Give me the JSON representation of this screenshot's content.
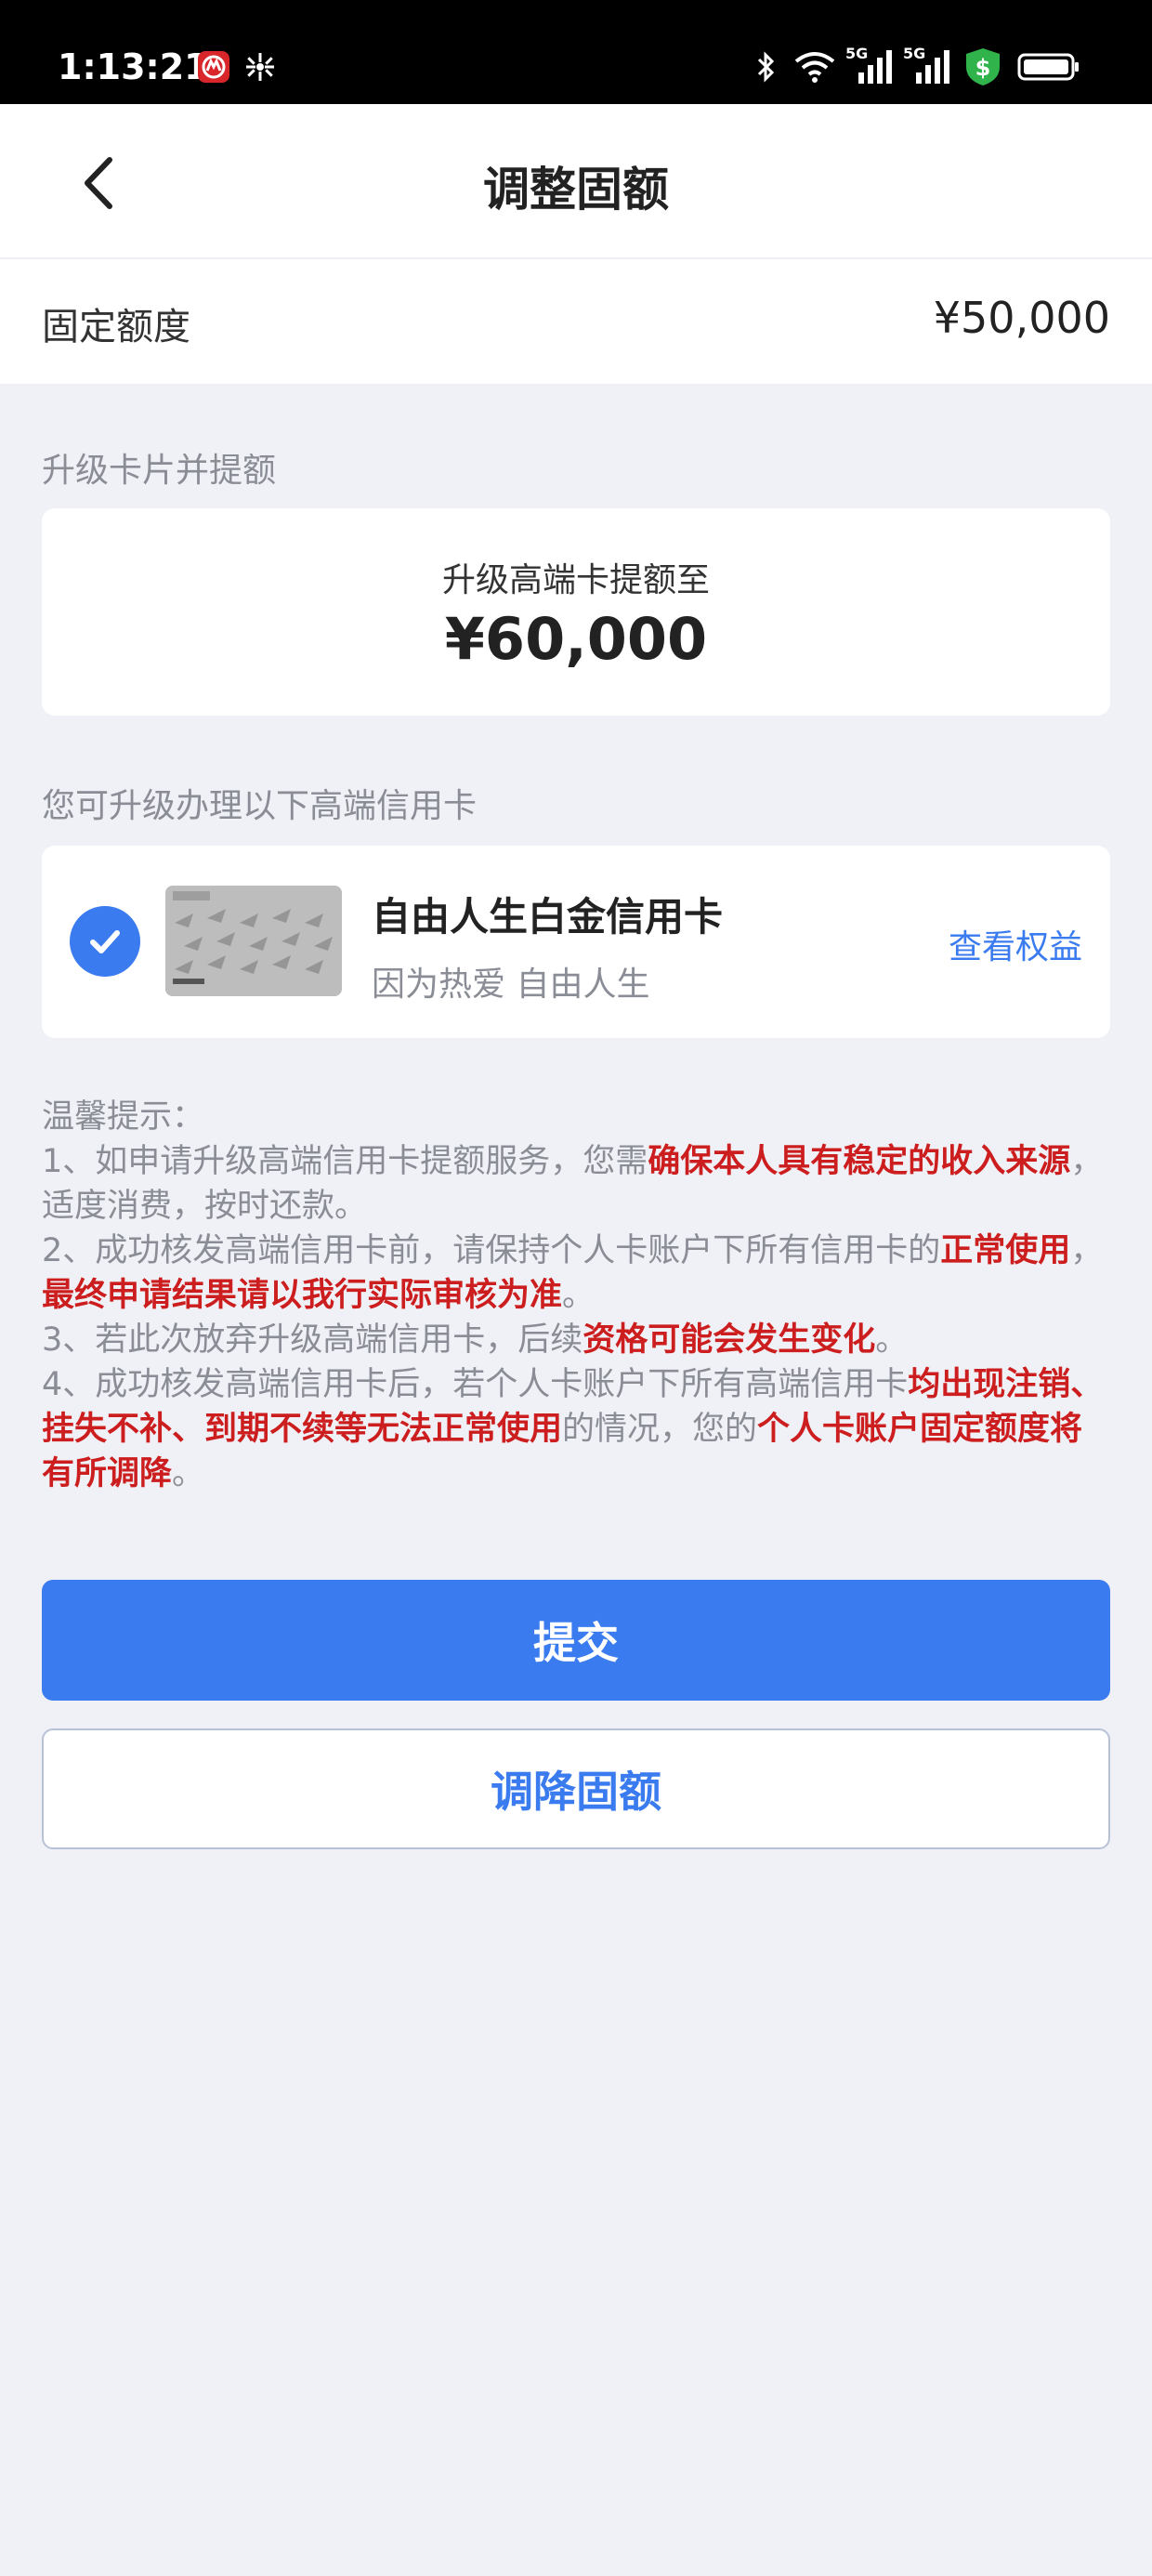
{
  "status_bar": {
    "time": "1:13:21",
    "icons": [
      "china-merchants-bank-icon",
      "pinwheel-icon",
      "bluetooth-icon",
      "wifi-icon",
      "signal-5g-icon",
      "signal-5g-icon",
      "shield-dollar-icon",
      "battery-icon"
    ],
    "network_label_1": "5G",
    "network_label_2": "5G"
  },
  "header": {
    "title": "调整固额"
  },
  "fixed_limit": {
    "label": "固定额度",
    "value": "¥50,000"
  },
  "upgrade_section": {
    "label": "升级卡片并提额",
    "subtitle": "升级高端卡提额至",
    "amount": "¥60,000"
  },
  "card_section": {
    "label": "您可升级办理以下高端信用卡",
    "card_name": "自由人生白金信用卡",
    "card_slogan": "因为热爱 自由人生",
    "view_benefits": "查看权益",
    "selected": true
  },
  "tips": {
    "title": "温馨提示：",
    "t1_a": "1、如申请升级高端信用卡提额服务，您需",
    "t1_b": "确保本人具有稳定的收入来源",
    "t1_c": "，适度消费，按时还款。",
    "t2_a": "2、成功核发高端信用卡前，请保持个人卡账户下所有信用卡的",
    "t2_b": "正常使用",
    "t2_c": "，",
    "t2_d": "最终申请结果请以我行实际审核为准",
    "t2_e": "。",
    "t3_a": "3、若此次放弃升级高端信用卡，后续",
    "t3_b": "资格可能会发生变化",
    "t3_c": "。",
    "t4_a": "4、成功核发高端信用卡后，若个人卡账户下所有高端信用卡",
    "t4_b": "均出现注销、挂失不补、到期不续等无法正常使用",
    "t4_c": "的情况，您的",
    "t4_d": "个人卡账户固定额度将有所调降",
    "t4_e": "。"
  },
  "buttons": {
    "submit": "提交",
    "lower_limit": "调降固额"
  },
  "colors": {
    "accent": "#3a7bef",
    "highlight_red": "#cc1e1e",
    "page_bg": "#f0f1f6"
  }
}
